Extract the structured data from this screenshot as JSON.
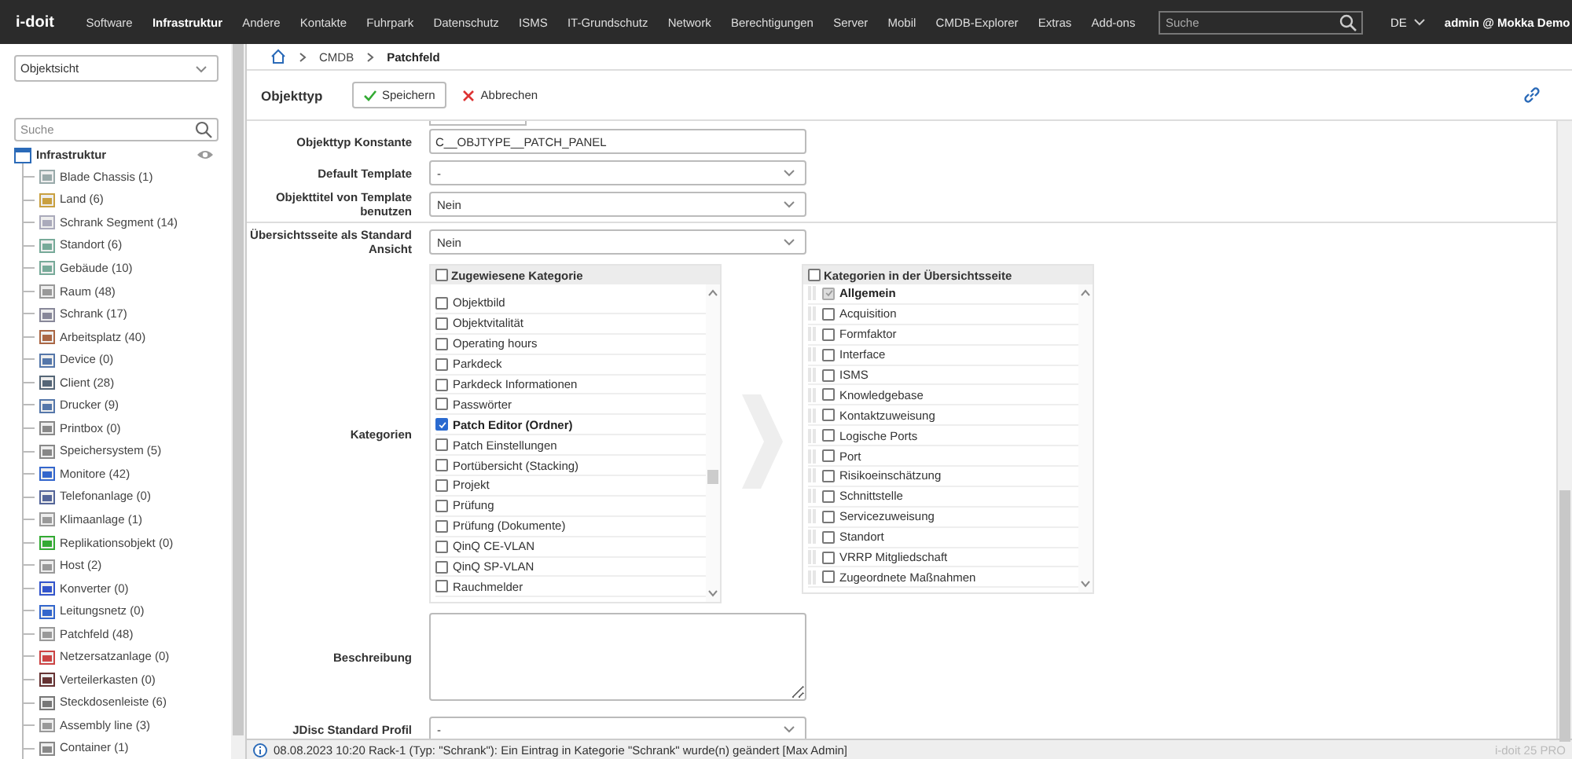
{
  "top_bar": {
    "logo": "i-doit",
    "menu": [
      {
        "label": "Software",
        "selected": false
      },
      {
        "label": "Infrastruktur",
        "selected": true
      },
      {
        "label": "Andere",
        "selected": false
      },
      {
        "label": "Kontakte",
        "selected": false
      },
      {
        "label": "Fuhrpark",
        "selected": false
      },
      {
        "label": "Datenschutz",
        "selected": false
      },
      {
        "label": "ISMS",
        "selected": false
      },
      {
        "label": "IT-Grundschutz",
        "selected": false
      },
      {
        "label": "Network",
        "selected": false
      },
      {
        "label": "Berechtigungen",
        "selected": false
      },
      {
        "label": "Server",
        "selected": false
      },
      {
        "label": "Mobil",
        "selected": false
      },
      {
        "label": "CMDB-Explorer",
        "selected": false
      },
      {
        "label": "Extras",
        "selected": false
      },
      {
        "label": "Add-ons",
        "selected": false
      }
    ],
    "search": {
      "placeholder": "Suche"
    },
    "language": "DE",
    "user": "admin @ Mokka Demo"
  },
  "sidebar": {
    "view_select": "Objektsicht",
    "search": {
      "placeholder": "Suche"
    },
    "tree": {
      "label": "Infrastruktur",
      "children": [
        {
          "label": "Blade Chassis (1)"
        },
        {
          "label": "Land (6)"
        },
        {
          "label": "Schrank Segment (14)"
        },
        {
          "label": "Standort (6)"
        },
        {
          "label": "Gebäude (10)"
        },
        {
          "label": "Raum (48)"
        },
        {
          "label": "Schrank (17)"
        },
        {
          "label": "Arbeitsplatz (40)"
        },
        {
          "label": "Device (0)"
        },
        {
          "label": "Client (28)"
        },
        {
          "label": "Drucker (9)"
        },
        {
          "label": "Printbox (0)"
        },
        {
          "label": "Speichersystem (5)"
        },
        {
          "label": "Monitore (42)"
        },
        {
          "label": "Telefonanlage (0)"
        },
        {
          "label": "Klimaanlage (1)"
        },
        {
          "label": "Replikationsobjekt (0)"
        },
        {
          "label": "Host (2)"
        },
        {
          "label": "Konverter (0)"
        },
        {
          "label": "Leitungsnetz (0)"
        },
        {
          "label": "Patchfeld (48)"
        },
        {
          "label": "Netzersatzanlage (0)"
        },
        {
          "label": "Verteilerkasten (0)"
        },
        {
          "label": "Steckdosenleiste (6)"
        },
        {
          "label": "Assembly line (3)"
        },
        {
          "label": "Container (1)"
        }
      ]
    }
  },
  "breadcrumb": [
    "CMDB",
    "Patchfeld"
  ],
  "toolbar": {
    "title": "Objekttyp",
    "save": "Speichern",
    "cancel": "Abbrechen"
  },
  "form": {
    "fields": [
      {
        "kind": "text",
        "label": "Objekttyp Konstante",
        "value": "C__OBJTYPE__PATCH_PANEL"
      },
      {
        "kind": "select",
        "label": "Default Template",
        "value": "-"
      },
      {
        "kind": "select",
        "label": "Objekttitel von Template benutzen",
        "value": "Nein"
      },
      {
        "kind": "select",
        "label": "Übersichtsseite als Standard Ansicht",
        "value": "Nein"
      }
    ],
    "categories": {
      "label": "Kategorien",
      "assigned": {
        "header": "Zugewiesene Kategorie",
        "checked": false,
        "items": [
          {
            "label": "Objektbild",
            "checked": false
          },
          {
            "label": "Objektvitalität",
            "checked": false
          },
          {
            "label": "Operating hours",
            "checked": false
          },
          {
            "label": "Parkdeck",
            "checked": false
          },
          {
            "label": "Parkdeck Informationen",
            "checked": false
          },
          {
            "label": "Passwörter",
            "checked": false
          },
          {
            "label": "Patch Editor (Ordner)",
            "checked": true
          },
          {
            "label": "Patch Einstellungen",
            "checked": false
          },
          {
            "label": "Portübersicht (Stacking)",
            "checked": false
          },
          {
            "label": "Projekt",
            "checked": false
          },
          {
            "label": "Prüfung",
            "checked": false
          },
          {
            "label": "Prüfung (Dokumente)",
            "checked": false
          },
          {
            "label": "QinQ CE-VLAN",
            "checked": false
          },
          {
            "label": "QinQ SP-VLAN",
            "checked": false
          },
          {
            "label": "Rauchmelder",
            "checked": false
          }
        ]
      },
      "overview": {
        "header": "Kategorien in der Übersichtsseite",
        "checked": false,
        "items": [
          {
            "label": "Allgemein",
            "checked": true,
            "disabled": true
          },
          {
            "label": "Acquisition",
            "checked": false,
            "disabled": false
          },
          {
            "label": "Formfaktor",
            "checked": false,
            "disabled": false
          },
          {
            "label": "Interface",
            "checked": false,
            "disabled": false
          },
          {
            "label": "ISMS",
            "checked": false,
            "disabled": false
          },
          {
            "label": "Knowledgebase",
            "checked": false,
            "disabled": false
          },
          {
            "label": "Kontaktzuweisung",
            "checked": false,
            "disabled": false
          },
          {
            "label": "Logische Ports",
            "checked": false,
            "disabled": false
          },
          {
            "label": "Port",
            "checked": false,
            "disabled": false
          },
          {
            "label": "Risikoeinschätzung",
            "checked": false,
            "disabled": false
          },
          {
            "label": "Schnittstelle",
            "checked": false,
            "disabled": false
          },
          {
            "label": "Servicezuweisung",
            "checked": false,
            "disabled": false
          },
          {
            "label": "Standort",
            "checked": false,
            "disabled": false
          },
          {
            "label": "VRRP Mitgliedschaft",
            "checked": false,
            "disabled": false
          },
          {
            "label": "Zugeordnete Maßnahmen",
            "checked": false,
            "disabled": false
          }
        ]
      }
    },
    "description": {
      "label": "Beschreibung"
    },
    "jdisc": {
      "label": "JDisc Standard Profil",
      "value": "-"
    }
  },
  "status_bar": {
    "message": "08.08.2023 10:20 Rack-1 (Typ: \"Schrank\"): Ein Eintrag in Kategorie \"Schrank\" wurde(n) geändert [Max Admin]",
    "version": "i-doit 25 PRO"
  }
}
